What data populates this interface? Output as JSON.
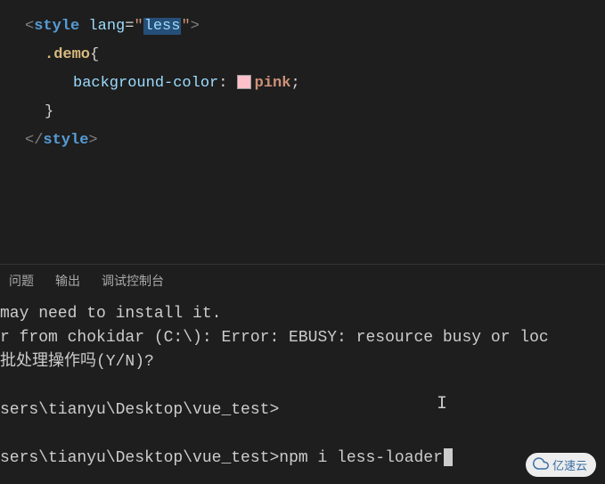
{
  "editor": {
    "tag_open_bracket": "<",
    "tag_style": "style",
    "space": " ",
    "attr_lang": "lang",
    "attr_eq": "=",
    "quote": "\"",
    "attr_value_less": "less",
    "tag_close_bracket": ">",
    "selector_demo": ".demo",
    "brace_open": "{",
    "prop_bg": "background-color",
    "colon": ":",
    "value_pink": "pink",
    "semi": ";",
    "brace_close": "}",
    "tag_end_open": "</",
    "tag_end_close": ">"
  },
  "colors": {
    "pink_swatch": "#ffc0cb"
  },
  "panel": {
    "tabs": {
      "problems": "问题",
      "output": "输出",
      "debug": "调试控制台"
    }
  },
  "terminal": {
    "line1": "may need to install it.",
    "line2": "r from chokidar (C:\\): Error: EBUSY: resource busy or loc",
    "line3": "批处理操作吗(Y/N)?",
    "line4_blank": " ",
    "line5": "sers\\tianyu\\Desktop\\vue_test>",
    "line6_blank": " ",
    "line7_prompt": "sers\\tianyu\\Desktop\\vue_test>",
    "line7_cmd": "npm i less-loader"
  },
  "watermark": {
    "text": "亿速云"
  }
}
